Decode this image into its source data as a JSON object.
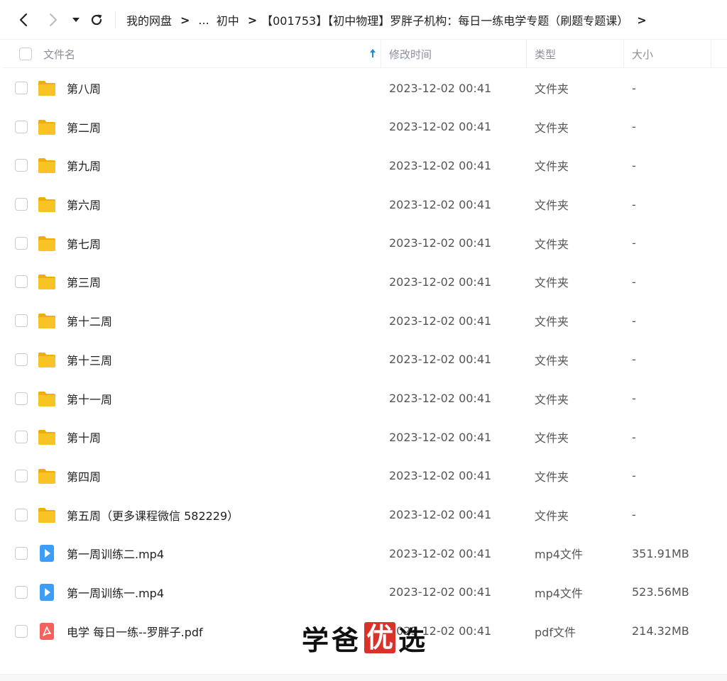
{
  "toolbar": {
    "back_icon": "chevron-left-icon",
    "forward_icon": "chevron-right-icon",
    "dropdown_icon": "caret-down-icon",
    "refresh_icon": "refresh-icon",
    "breadcrumbs": [
      "我的网盘",
      "...",
      "初中",
      "【001753】【初中物理】罗胖子机构：每日一练电学专题（刷题专题课）"
    ],
    "separator": ">"
  },
  "header": {
    "col_name": "文件名",
    "col_modified": "修改时间",
    "col_type": "类型",
    "col_size": "大小",
    "sort_icon": "sort-ascending-icon"
  },
  "files": [
    {
      "name": "第八周",
      "modified": "2023-12-02 00:41",
      "type": "文件夹",
      "size": "-",
      "icon": "folder-icon"
    },
    {
      "name": "第二周",
      "modified": "2023-12-02 00:41",
      "type": "文件夹",
      "size": "-",
      "icon": "folder-icon"
    },
    {
      "name": "第九周",
      "modified": "2023-12-02 00:41",
      "type": "文件夹",
      "size": "-",
      "icon": "folder-icon"
    },
    {
      "name": "第六周",
      "modified": "2023-12-02 00:41",
      "type": "文件夹",
      "size": "-",
      "icon": "folder-icon"
    },
    {
      "name": "第七周",
      "modified": "2023-12-02 00:41",
      "type": "文件夹",
      "size": "-",
      "icon": "folder-icon"
    },
    {
      "name": "第三周",
      "modified": "2023-12-02 00:41",
      "type": "文件夹",
      "size": "-",
      "icon": "folder-icon"
    },
    {
      "name": "第十二周",
      "modified": "2023-12-02 00:41",
      "type": "文件夹",
      "size": "-",
      "icon": "folder-icon"
    },
    {
      "name": "第十三周",
      "modified": "2023-12-02 00:41",
      "type": "文件夹",
      "size": "-",
      "icon": "folder-icon"
    },
    {
      "name": "第十一周",
      "modified": "2023-12-02 00:41",
      "type": "文件夹",
      "size": "-",
      "icon": "folder-icon"
    },
    {
      "name": "第十周",
      "modified": "2023-12-02 00:41",
      "type": "文件夹",
      "size": "-",
      "icon": "folder-icon"
    },
    {
      "name": "第四周",
      "modified": "2023-12-02 00:41",
      "type": "文件夹",
      "size": "-",
      "icon": "folder-icon"
    },
    {
      "name": "第五周（更多课程微信 582229）",
      "modified": "2023-12-02 00:41",
      "type": "文件夹",
      "size": "-",
      "icon": "folder-icon"
    },
    {
      "name": "第一周训练二.mp4",
      "modified": "2023-12-02 00:41",
      "type": "mp4文件",
      "size": "351.91MB",
      "icon": "video-file-icon"
    },
    {
      "name": "第一周训练一.mp4",
      "modified": "2023-12-02 00:41",
      "type": "mp4文件",
      "size": "523.56MB",
      "icon": "video-file-icon"
    },
    {
      "name": "电学 每日一练--罗胖子.pdf",
      "modified": "2023-12-02 00:41",
      "type": "pdf文件",
      "size": "214.32MB",
      "icon": "pdf-file-icon"
    }
  ],
  "watermark": {
    "part1": "学爸",
    "part2": "优",
    "part3": "选"
  },
  "colors": {
    "folder": "#f7c325",
    "folder_dark": "#f0ad0e",
    "video": "#3d9cf5",
    "pdf": "#f5625c",
    "sort_arrow": "#1e88e5",
    "watermark_red": "#d9322b"
  }
}
